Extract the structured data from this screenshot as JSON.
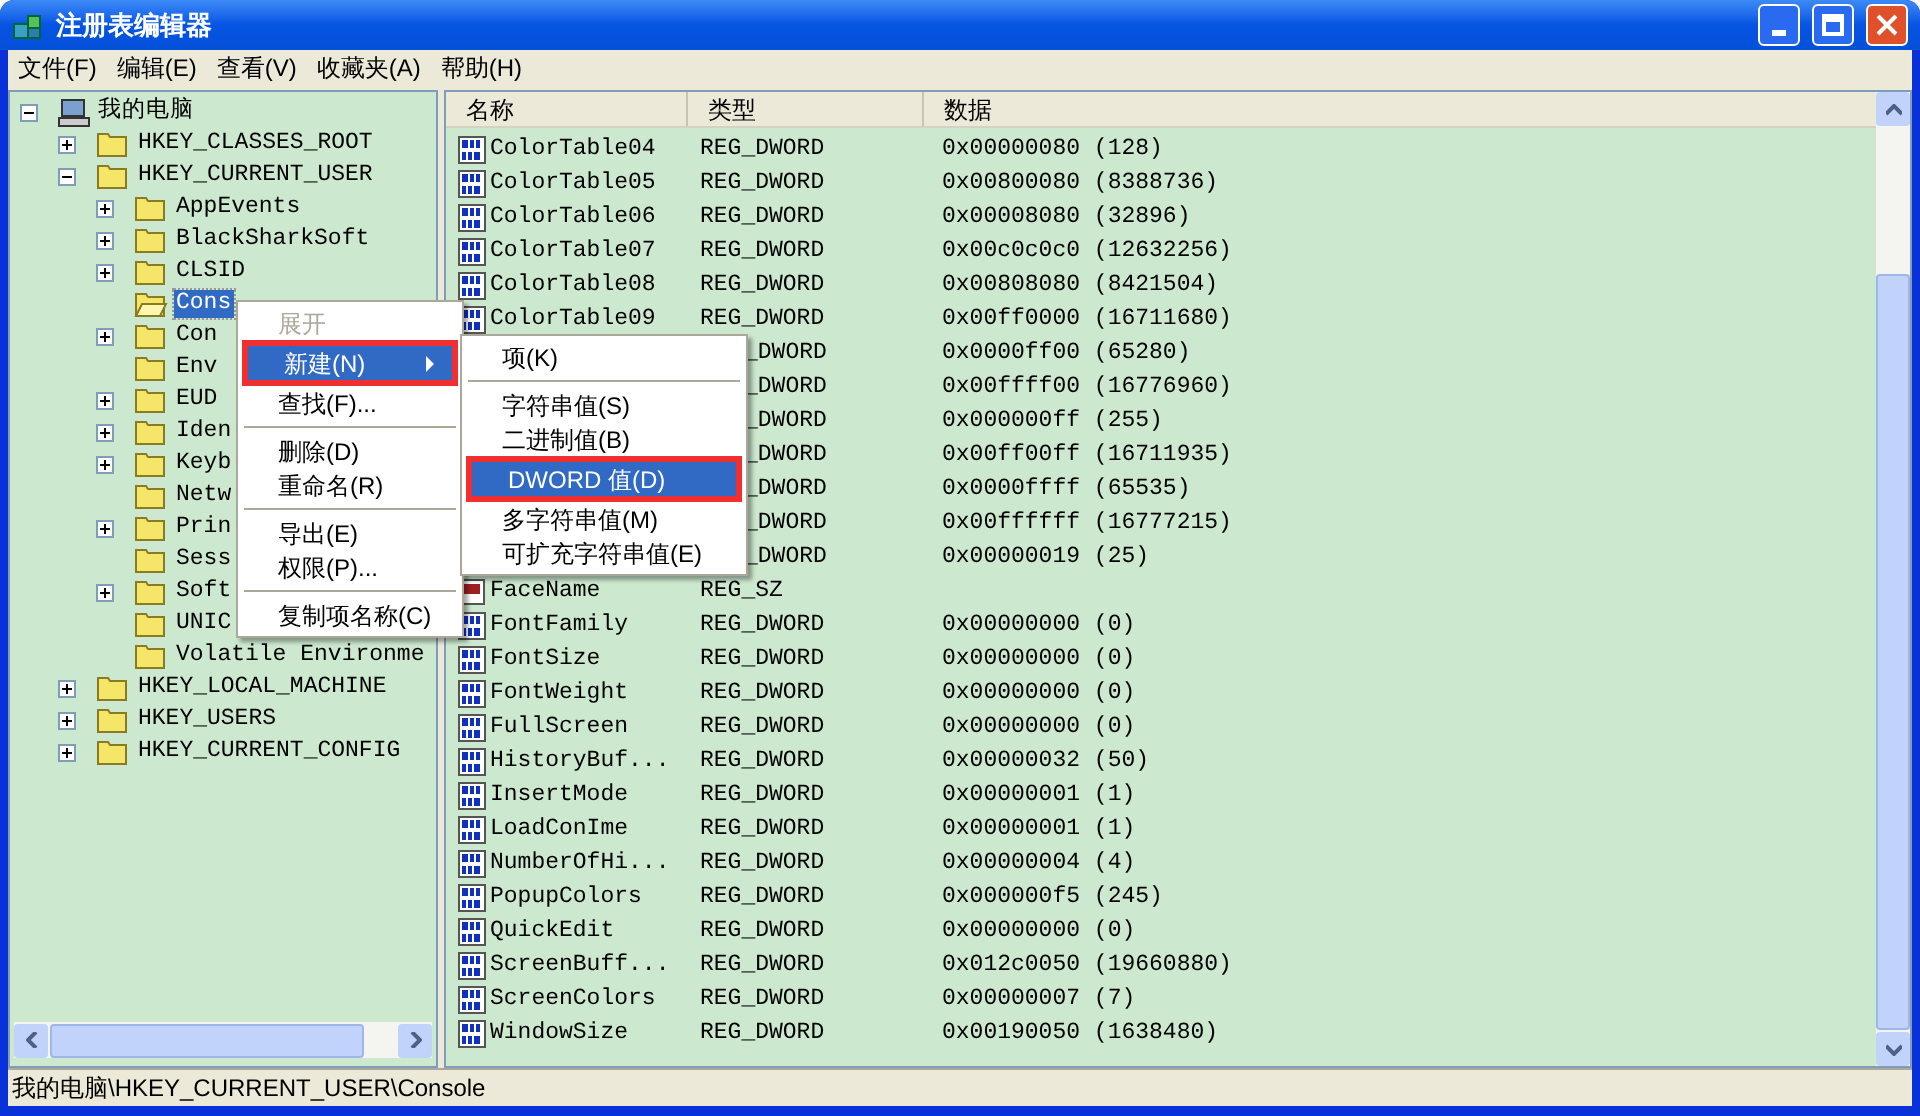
{
  "window": {
    "title": "注册表编辑器"
  },
  "menu": [
    "文件(F)",
    "编辑(E)",
    "查看(V)",
    "收藏夹(A)",
    "帮助(H)"
  ],
  "tree": {
    "label": "我的电脑",
    "expanded": true,
    "selected": false,
    "children": [
      {
        "label": "HKEY_CLASSES_ROOT",
        "expanded": false,
        "selected": false
      },
      {
        "label": "HKEY_CURRENT_USER",
        "expanded": true,
        "selected": false,
        "children": [
          {
            "label": "AppEvents",
            "expanded": false,
            "selected": false
          },
          {
            "label": "BlackSharkSoft",
            "expanded": false,
            "selected": false
          },
          {
            "label": "CLSID",
            "expanded": false,
            "selected": false
          },
          {
            "label": "Cons",
            "selected": true
          },
          {
            "label": "Con",
            "expanded": false,
            "selected": false
          },
          {
            "label": "Env",
            "selected": false
          },
          {
            "label": "EUD",
            "expanded": false,
            "selected": false
          },
          {
            "label": "Iden",
            "expanded": false,
            "selected": false
          },
          {
            "label": "Keyb",
            "expanded": false,
            "selected": false
          },
          {
            "label": "Netw",
            "selected": false
          },
          {
            "label": "Prin",
            "expanded": false,
            "selected": false
          },
          {
            "label": "Sess",
            "selected": false
          },
          {
            "label": "Soft",
            "expanded": false,
            "selected": false
          },
          {
            "label": "UNIC",
            "selected": false
          },
          {
            "label": "Volatile Environme",
            "selected": false
          }
        ]
      },
      {
        "label": "HKEY_LOCAL_MACHINE",
        "expanded": false,
        "selected": false
      },
      {
        "label": "HKEY_USERS",
        "expanded": false,
        "selected": false
      },
      {
        "label": "HKEY_CURRENT_CONFIG",
        "expanded": false,
        "selected": false
      }
    ]
  },
  "table": {
    "columns": [
      "名称",
      "类型",
      "数据"
    ],
    "rows": [
      {
        "kind": "dword",
        "name": "ColorTable04",
        "type": "REG_DWORD",
        "data": "0x00000080 (128)"
      },
      {
        "kind": "dword",
        "name": "ColorTable05",
        "type": "REG_DWORD",
        "data": "0x00800080 (8388736)"
      },
      {
        "kind": "dword",
        "name": "ColorTable06",
        "type": "REG_DWORD",
        "data": "0x00008080 (32896)"
      },
      {
        "kind": "dword",
        "name": "ColorTable07",
        "type": "REG_DWORD",
        "data": "0x00c0c0c0 (12632256)"
      },
      {
        "kind": "dword",
        "name": "ColorTable08",
        "type": "REG_DWORD",
        "data": "0x00808080 (8421504)"
      },
      {
        "kind": "dword",
        "name": "ColorTable09",
        "type": "REG_DWORD",
        "data": "0x00ff0000 (16711680)"
      },
      {
        "kind": "covered",
        "type": "_DWORD",
        "data": "0x0000ff00 (65280)"
      },
      {
        "kind": "covered",
        "type": "_DWORD",
        "data": "0x00ffff00 (16776960)"
      },
      {
        "kind": "covered",
        "type": "_DWORD",
        "data": "0x000000ff (255)"
      },
      {
        "kind": "covered",
        "type": "_DWORD",
        "data": "0x00ff00ff (16711935)"
      },
      {
        "kind": "covered",
        "type": "_DWORD",
        "data": "0x0000ffff (65535)"
      },
      {
        "kind": "covered",
        "type": "_DWORD",
        "data": "0x00ffffff (16777215)"
      },
      {
        "kind": "covered",
        "type": "_DWORD",
        "data": "0x00000019 (25)"
      },
      {
        "kind": "string",
        "name": "FaceName",
        "type": "REG_SZ"
      },
      {
        "kind": "dword",
        "name": "FontFamily",
        "type": "REG_DWORD",
        "data": "0x00000000 (0)"
      },
      {
        "kind": "dword",
        "name": "FontSize",
        "type": "REG_DWORD",
        "data": "0x00000000 (0)"
      },
      {
        "kind": "dword",
        "name": "FontWeight",
        "type": "REG_DWORD",
        "data": "0x00000000 (0)"
      },
      {
        "kind": "dword",
        "name": "FullScreen",
        "type": "REG_DWORD",
        "data": "0x00000000 (0)"
      },
      {
        "kind": "dword",
        "name": "HistoryBuf...",
        "type": "REG_DWORD",
        "data": "0x00000032 (50)"
      },
      {
        "kind": "dword",
        "name": "InsertMode",
        "type": "REG_DWORD",
        "data": "0x00000001 (1)"
      },
      {
        "kind": "dword",
        "name": "LoadConIme",
        "type": "REG_DWORD",
        "data": "0x00000001 (1)"
      },
      {
        "kind": "dword",
        "name": "NumberOfHi...",
        "type": "REG_DWORD",
        "data": "0x00000004 (4)"
      },
      {
        "kind": "dword",
        "name": "PopupColors",
        "type": "REG_DWORD",
        "data": "0x000000f5 (245)"
      },
      {
        "kind": "dword",
        "name": "QuickEdit",
        "type": "REG_DWORD",
        "data": "0x00000000 (0)"
      },
      {
        "kind": "dword",
        "name": "ScreenBuff...",
        "type": "REG_DWORD",
        "data": "0x012c0050 (19660880)"
      },
      {
        "kind": "dword",
        "name": "ScreenColors",
        "type": "REG_DWORD",
        "data": "0x00000007 (7)"
      },
      {
        "kind": "dword",
        "name": "WindowSize",
        "type": "REG_DWORD",
        "data": "0x00190050 (1638480)"
      }
    ]
  },
  "context_menu": [
    {
      "kind": "item",
      "label": "展开",
      "disabled": true,
      "selected": false,
      "annotated": false
    },
    {
      "kind": "item",
      "label": "新建(N)",
      "disabled": false,
      "selected": true,
      "annotated": true,
      "submenu": true
    },
    {
      "kind": "item",
      "label": "查找(F)...",
      "disabled": false,
      "selected": false,
      "annotated": false
    },
    {
      "kind": "separator"
    },
    {
      "kind": "item",
      "label": "删除(D)",
      "disabled": false,
      "selected": false,
      "annotated": false
    },
    {
      "kind": "item",
      "label": "重命名(R)",
      "disabled": false,
      "selected": false,
      "annotated": false
    },
    {
      "kind": "separator"
    },
    {
      "kind": "item",
      "label": "导出(E)",
      "disabled": false,
      "selected": false,
      "annotated": false
    },
    {
      "kind": "item",
      "label": "权限(P)...",
      "disabled": false,
      "selected": false,
      "annotated": false
    },
    {
      "kind": "separator"
    },
    {
      "kind": "item",
      "label": "复制项名称(C)",
      "disabled": false,
      "selected": false,
      "annotated": false
    }
  ],
  "submenu": [
    {
      "kind": "item",
      "label": "项(K)",
      "selected": false,
      "annotated": false
    },
    {
      "kind": "separator"
    },
    {
      "kind": "item",
      "label": "字符串值(S)",
      "selected": false,
      "annotated": false
    },
    {
      "kind": "item",
      "label": "二进制值(B)",
      "selected": false,
      "annotated": false
    },
    {
      "kind": "item",
      "label": "DWORD 值(D)",
      "selected": true,
      "annotated": true
    },
    {
      "kind": "item",
      "label": "多字符串值(M)",
      "selected": false,
      "annotated": false
    },
    {
      "kind": "item",
      "label": "可扩充字符串值(E)",
      "selected": false,
      "annotated": false
    }
  ],
  "status_bar": "我的电脑\\HKEY_CURRENT_USER\\Console"
}
